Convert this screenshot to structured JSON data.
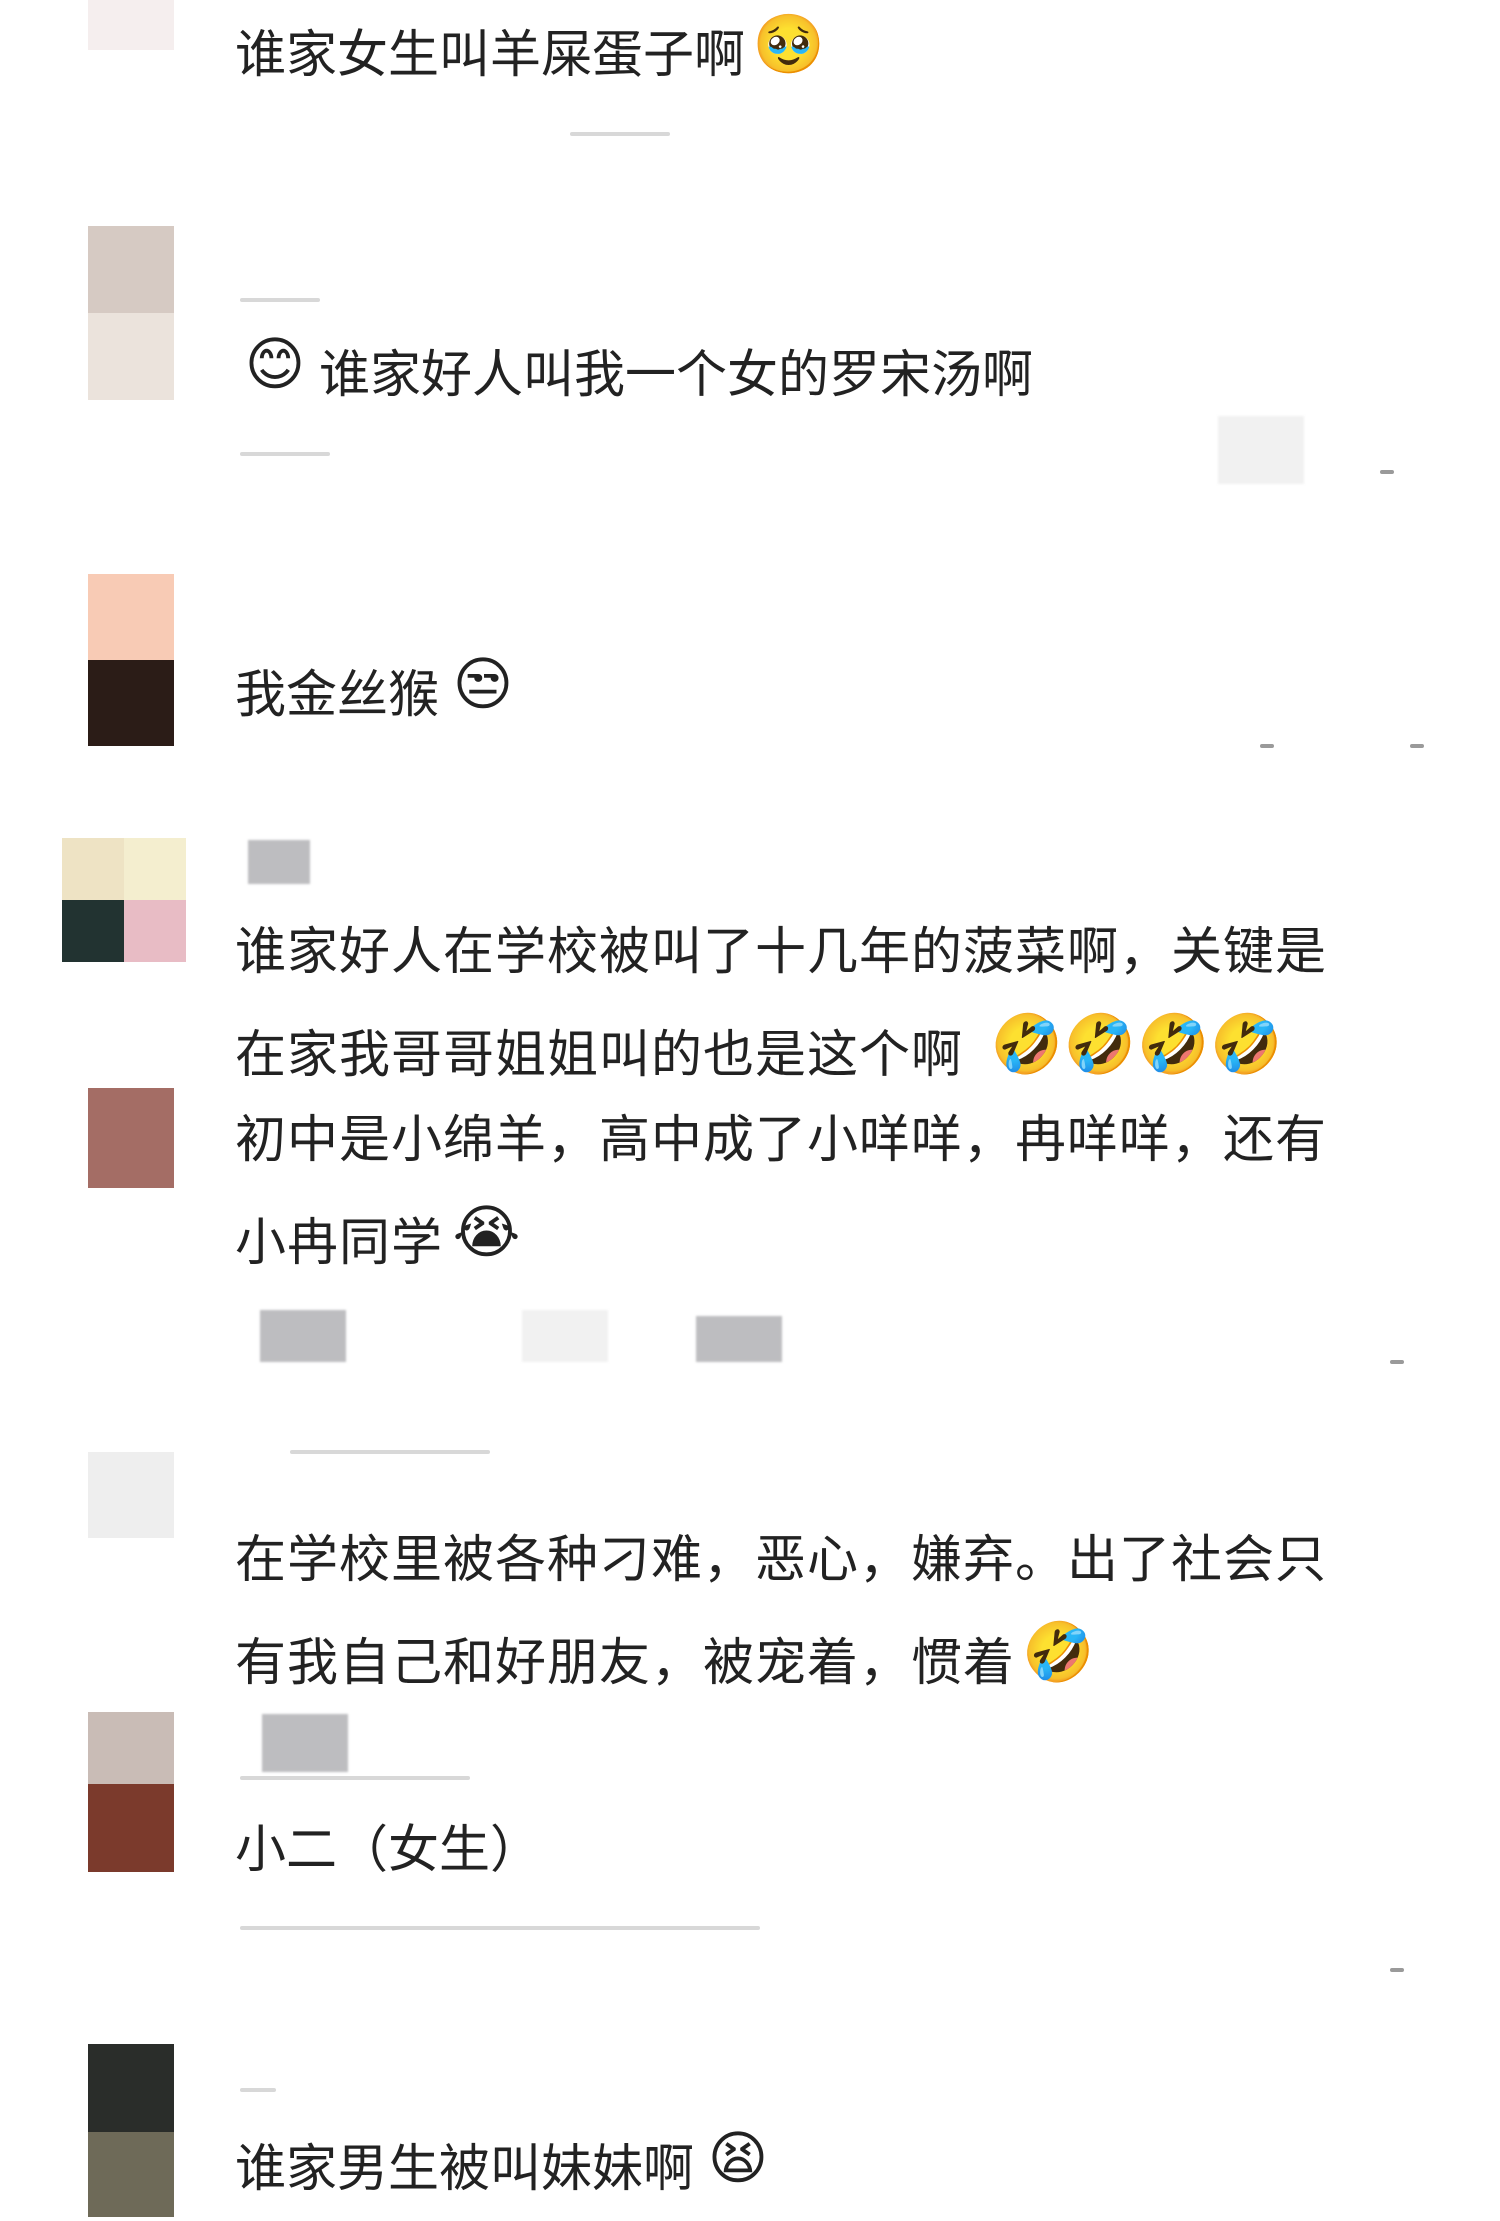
{
  "comments": [
    {
      "text": [
        "谁家女生叫羊屎蛋子啊"
      ],
      "emoji": [
        "🥹"
      ],
      "avatar_colors": [
        "#f5eeee"
      ]
    },
    {
      "text": [
        "谁家好人叫我一个女的罗宋汤啊"
      ],
      "emoji": [
        "😊"
      ],
      "avatar_colors": [
        "#d6cac3",
        "#ebe3dc"
      ]
    },
    {
      "text": [
        "我金丝猴"
      ],
      "emoji": [
        "😒"
      ],
      "avatar_colors": [
        "#f8cbb5",
        "#2b1c17"
      ]
    },
    {
      "text": [
        "谁家好人在学校被叫了十几年的菠菜啊，关键是",
        "在家我哥哥姐姐叫的也是这个啊"
      ],
      "emoji": [
        "🤣🤣🤣🤣"
      ],
      "avatar_colors": [
        "#eee3c4",
        "#f4eecf",
        "#223331",
        "#e8bcc5"
      ]
    },
    {
      "text": [
        "初中是小绵羊，高中成了小咩咩，冉咩咩，还有",
        "小冉同学"
      ],
      "emoji": [
        "😭"
      ],
      "avatar_colors": [
        "#a46d65"
      ]
    },
    {
      "text": [
        "在学校里被各种刁难，恶心，嫌弃。出了社会只",
        "有我自己和好朋友，被宠着，惯着"
      ],
      "emoji": [
        "🤣"
      ],
      "avatar_colors": [
        "#eeeeee"
      ]
    },
    {
      "text": [
        "小二（女生）"
      ],
      "emoji": [],
      "avatar_colors": [
        "#c9bcb6",
        "#7b3a2c"
      ]
    },
    {
      "text": [
        "谁家男生被叫妹妹啊"
      ],
      "emoji": [
        "😫"
      ],
      "avatar_colors": [
        "#2a2d2a",
        "#6e6a58"
      ]
    }
  ]
}
